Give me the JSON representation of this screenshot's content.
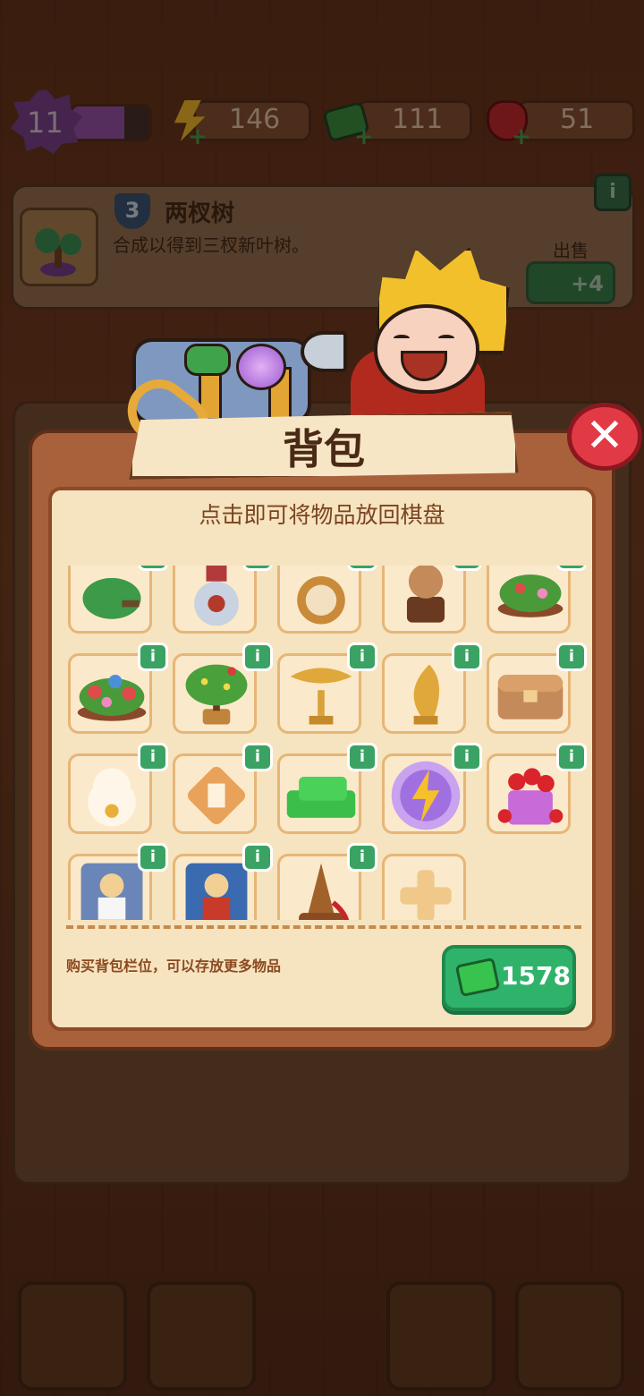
{
  "hud": {
    "level": "11",
    "level_progress": 0.68,
    "energy": "146",
    "cash": "111",
    "gems": "51"
  },
  "info": {
    "tier": "3",
    "title": "两杈树",
    "description": "合成以得到三杈新叶树。",
    "sell_label": "出售",
    "sell_value": "+4",
    "info_icon": "i"
  },
  "backpack": {
    "title": "背包",
    "hint": "点击即可将物品放回棋盘",
    "close_icon": "✕",
    "info_icon": "i",
    "items": [
      {
        "name": "leafy-plant"
      },
      {
        "name": "painted-vase"
      },
      {
        "name": "pocket-watch"
      },
      {
        "name": "warrior-bust"
      },
      {
        "name": "flower-bush"
      },
      {
        "name": "flower-bed"
      },
      {
        "name": "fruit-bonsai"
      },
      {
        "name": "golden-eagle-trophy"
      },
      {
        "name": "golden-phoenix-trophy"
      },
      {
        "name": "treasure-chest"
      },
      {
        "name": "lucky-cat"
      },
      {
        "name": "hourglass-tile"
      },
      {
        "name": "cash-pile"
      },
      {
        "name": "energy-orb"
      },
      {
        "name": "gem-bag"
      },
      {
        "name": "portrait-card-1"
      },
      {
        "name": "portrait-card-2"
      },
      {
        "name": "hat-stand"
      },
      {
        "name": "add-slot"
      }
    ],
    "buy_description": "购买背包栏位，可以存放更多物品",
    "buy_price": "1578"
  },
  "colors": {
    "modal": "#a8613a",
    "panel": "#f6e3bf",
    "accent_green": "#2fb36a",
    "close_red": "#e23a44"
  }
}
